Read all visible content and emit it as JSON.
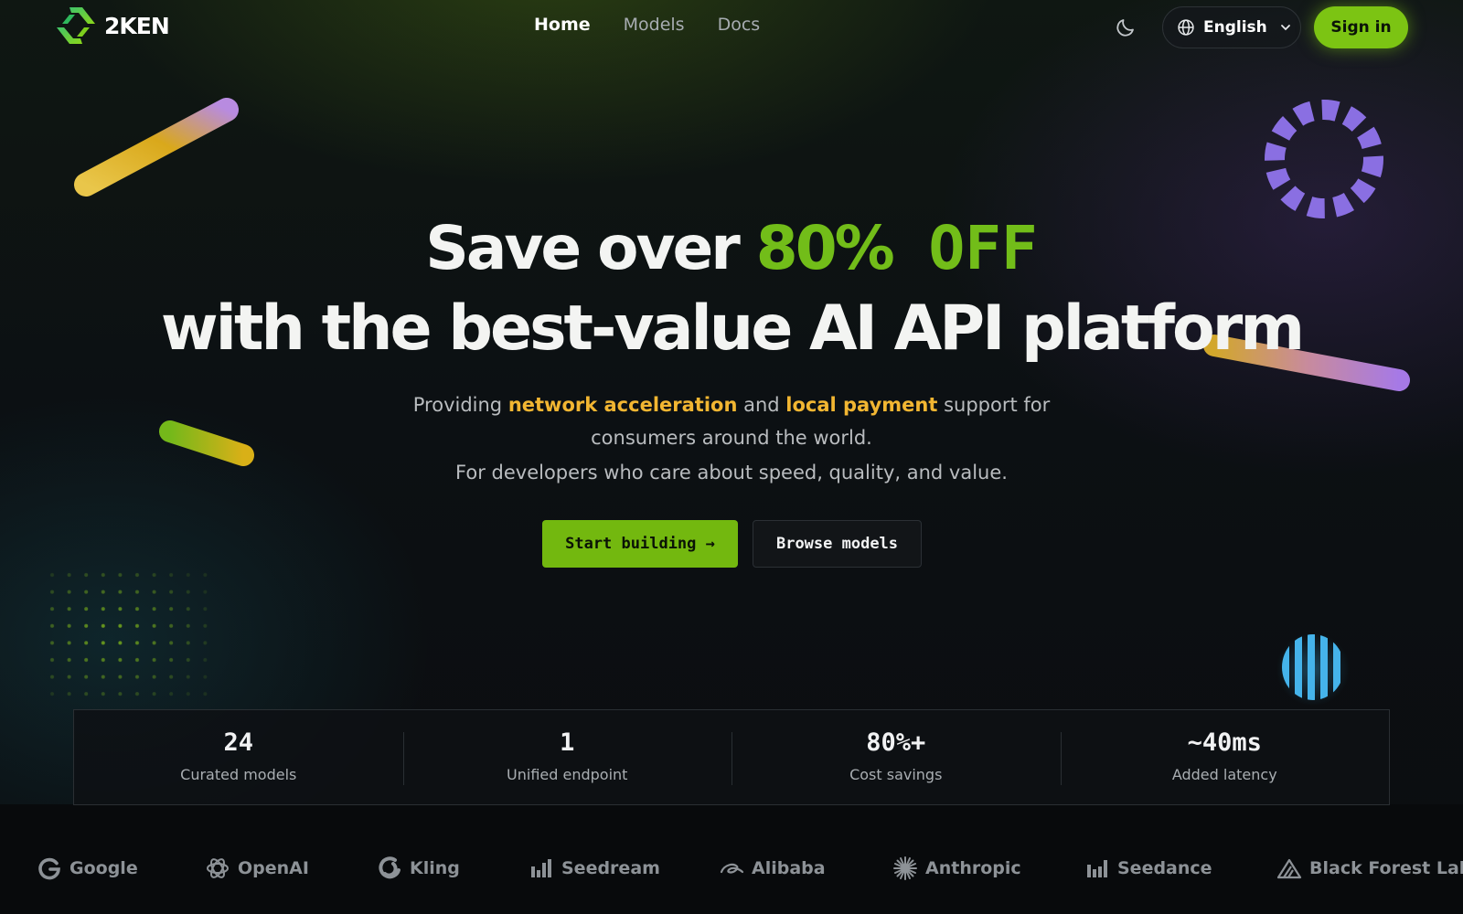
{
  "brand": {
    "name": "2KEN"
  },
  "nav": {
    "items": [
      {
        "label": "Home",
        "active": true
      },
      {
        "label": "Models",
        "active": false
      },
      {
        "label": "Docs",
        "active": false
      }
    ]
  },
  "header": {
    "theme_icon": "moon-icon",
    "language": {
      "label": "English",
      "icon": "globe-icon"
    },
    "signin_label": "Sign in"
  },
  "hero": {
    "line1_prefix": "Save over ",
    "line1_percent": "80%",
    "line1_off": " OFF",
    "line2": "with the best-value AI API platform",
    "sub1_a": "Providing ",
    "sub1_hl1": "network acceleration",
    "sub1_b": " and ",
    "sub1_hl2": "local payment",
    "sub1_c": " support for",
    "sub2": "consumers around the world.",
    "sub3": "For developers who care about speed, quality, and value.",
    "cta_primary": "Start building →",
    "cta_secondary": "Browse models"
  },
  "stats": [
    {
      "value": "24",
      "label": "Curated models"
    },
    {
      "value": "1",
      "label": "Unified endpoint"
    },
    {
      "value": "80%+",
      "label": "Cost savings"
    },
    {
      "value": "~40ms",
      "label": "Added latency"
    }
  ],
  "partners": [
    {
      "name": "Google",
      "icon": "google-icon"
    },
    {
      "name": "OpenAI",
      "icon": "openai-icon"
    },
    {
      "name": "Kling",
      "icon": "kling-icon"
    },
    {
      "name": "Seedream",
      "icon": "seedream-icon"
    },
    {
      "name": "Alibaba",
      "icon": "alibaba-icon"
    },
    {
      "name": "Anthropic",
      "icon": "anthropic-icon"
    },
    {
      "name": "Seedance",
      "icon": "seedance-icon"
    },
    {
      "name": "Black Forest Labs",
      "icon": "black-forest-labs-icon"
    }
  ],
  "colors": {
    "accent_green": "#72bd19",
    "highlight_yellow": "#f2b632",
    "background": "#0c1112"
  }
}
